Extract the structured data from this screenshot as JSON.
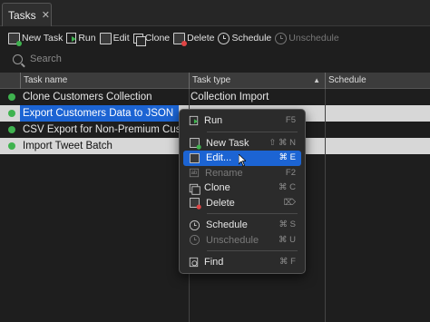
{
  "tab": {
    "label": "Tasks",
    "close": "✕"
  },
  "toolbar": {
    "items": [
      {
        "label": "New Task"
      },
      {
        "label": "Run"
      },
      {
        "label": "Edit"
      },
      {
        "label": "Clone"
      },
      {
        "label": "Delete"
      },
      {
        "label": "Schedule"
      },
      {
        "label": "Unschedule",
        "disabled": true
      }
    ]
  },
  "search": {
    "placeholder": "Search"
  },
  "table": {
    "columns": [
      "Task name",
      "Task type",
      "Schedule"
    ],
    "sort_indicator": "▲",
    "rows": [
      {
        "name": "Clone Customers Collection",
        "type": "Collection Import",
        "schedule": ""
      },
      {
        "name": "Export Customers Data to JSON",
        "type": "",
        "schedule": ""
      },
      {
        "name": "CSV Export for Non-Premium Customers",
        "type": "",
        "schedule": ""
      },
      {
        "name": "Import Tweet Batch",
        "type": "",
        "schedule": ""
      }
    ]
  },
  "context_menu": {
    "items": [
      {
        "label": "Run",
        "shortcut": "F5"
      },
      {
        "label": "New Task",
        "shortcut": "⇧ ⌘ N"
      },
      {
        "label": "Edit...",
        "shortcut": "⌘ E"
      },
      {
        "label": "Rename",
        "shortcut": "F2",
        "disabled": true
      },
      {
        "label": "Clone",
        "shortcut": "⌘ C"
      },
      {
        "label": "Delete",
        "shortcut": "⌦"
      },
      {
        "label": "Schedule",
        "shortcut": "⌘ S"
      },
      {
        "label": "Unschedule",
        "shortcut": "⌘ U",
        "disabled": true
      },
      {
        "label": "Find",
        "shortcut": "⌘ F"
      }
    ]
  },
  "colors": {
    "selection": "#1c64d3",
    "status_active": "#3fb34f",
    "delete_accent": "#e04545"
  }
}
